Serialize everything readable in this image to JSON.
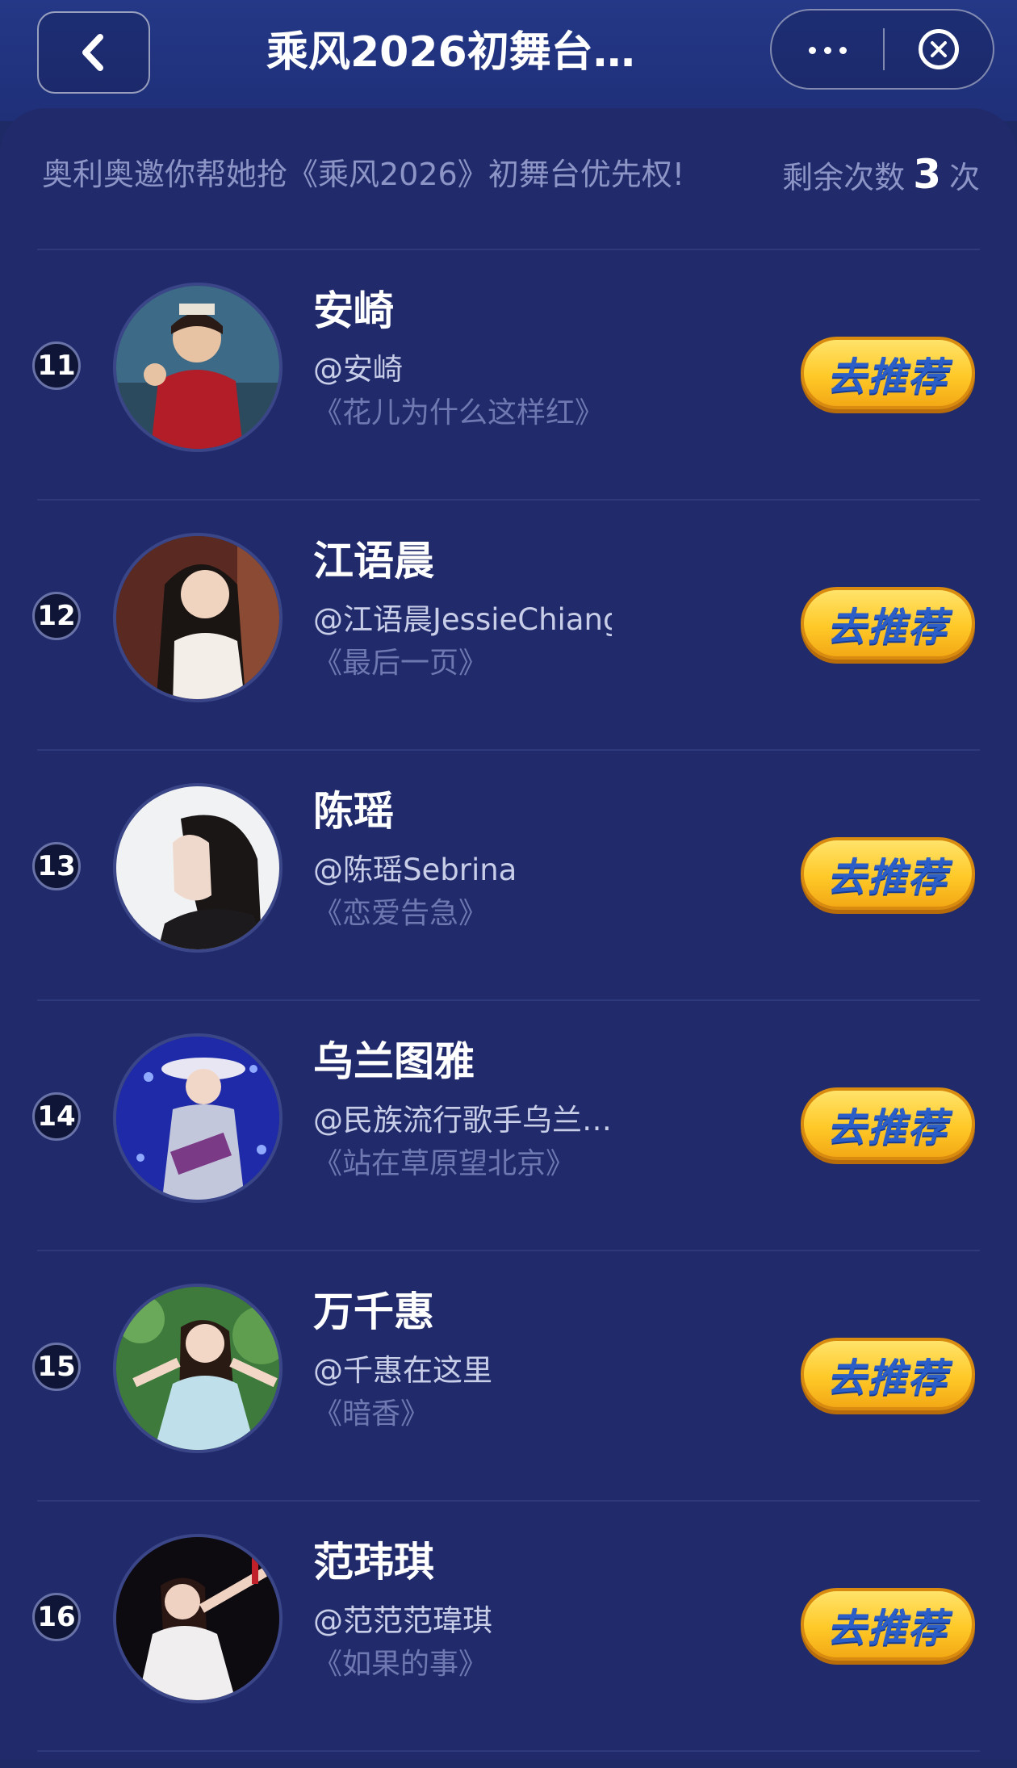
{
  "header": {
    "title": "乘风2026初舞台…",
    "back_icon": "chevron-left-icon",
    "more_icon": "more-dots-icon",
    "close_icon": "close-circle-icon"
  },
  "invite_text": "奥利奥邀你帮她抢《乘风2026》初舞台优先权!",
  "remaining": {
    "prefix": "剩余次数",
    "count": "3",
    "suffix": "次"
  },
  "recommend_label": "去推荐",
  "contestants": [
    {
      "rank": "11",
      "name": "安崎",
      "handle": "@安崎",
      "song": "《花儿为什么这样红》"
    },
    {
      "rank": "12",
      "name": "江语晨",
      "handle": "@江语晨JessieChiang",
      "song": "《最后一页》"
    },
    {
      "rank": "13",
      "name": "陈瑶",
      "handle": "@陈瑶Sebrina",
      "song": "《恋爱告急》"
    },
    {
      "rank": "14",
      "name": "乌兰图雅",
      "handle": "@民族流行歌手乌兰…",
      "song": "《站在草原望北京》"
    },
    {
      "rank": "15",
      "name": "万千惠",
      "handle": "@千惠在这里",
      "song": "《暗香》"
    },
    {
      "rank": "16",
      "name": "范玮琪",
      "handle": "@范范范瑋琪",
      "song": "《如果的事》"
    }
  ],
  "colors": {
    "background": "#212b6b",
    "button_yellow": "#ffc928",
    "button_text": "#2c5ec8"
  }
}
